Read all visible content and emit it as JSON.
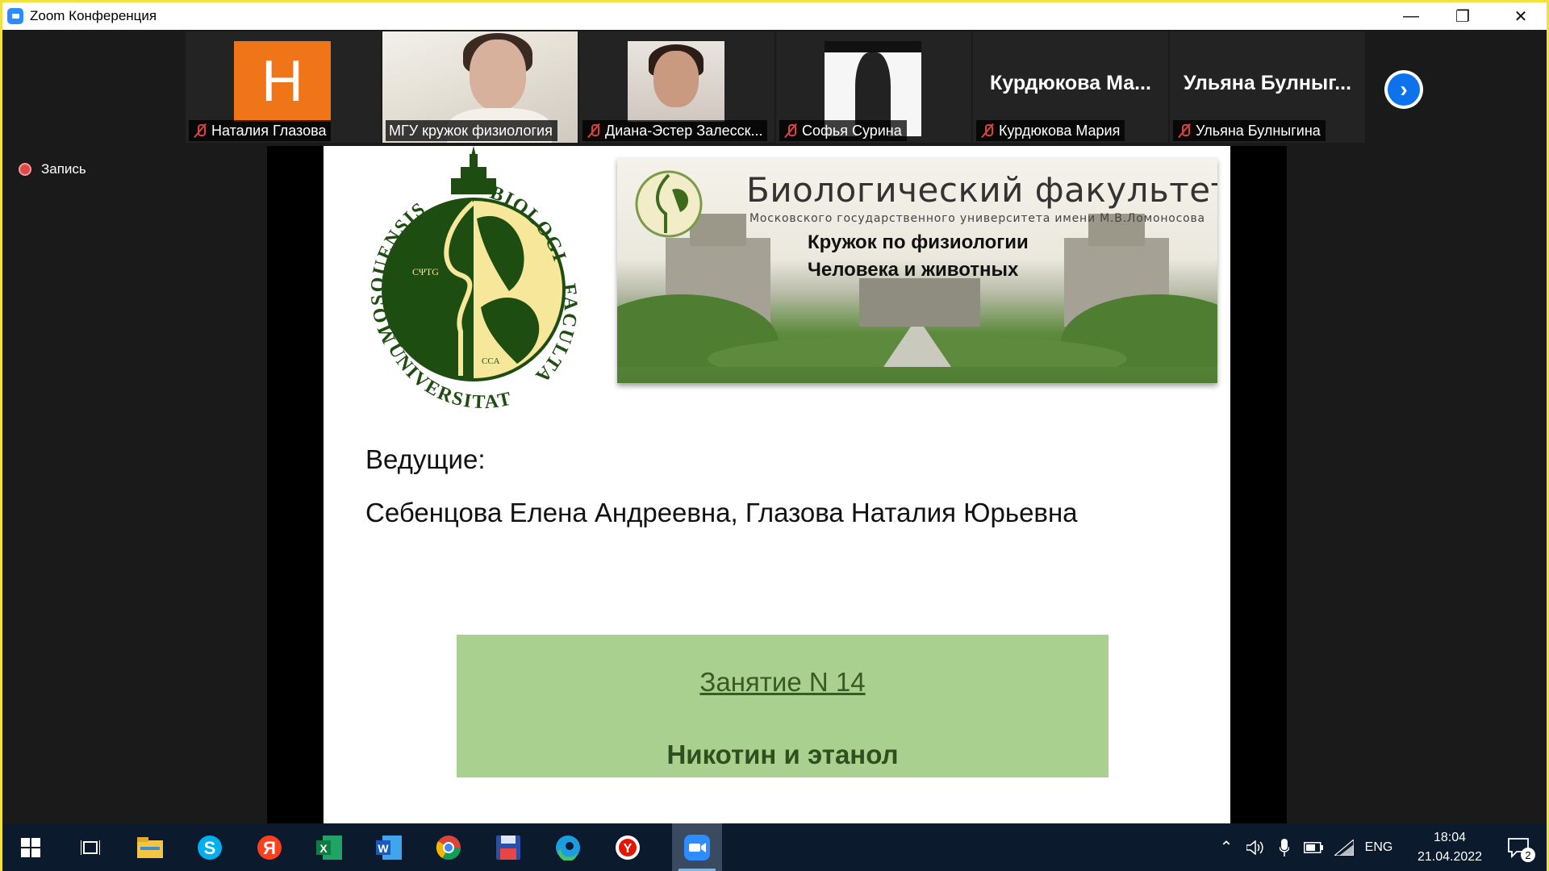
{
  "window": {
    "title": "Zoom Конференция",
    "minimize": "—",
    "restore": "❐",
    "close": "✕"
  },
  "participants": [
    {
      "name": "Наталия Глазова",
      "avatar_letter": "H",
      "avatar_color": "#f07418",
      "muted": true,
      "kind": "avatar"
    },
    {
      "name": "МГУ кружок физиология",
      "muted": false,
      "kind": "video-woman",
      "active": true
    },
    {
      "name": "Диана-Эстер Залесск...",
      "muted": true,
      "kind": "video-girl"
    },
    {
      "name": "Софья Сурина",
      "muted": true,
      "kind": "image-manga"
    },
    {
      "name": "Курдюкова Мария",
      "display": "Курдюкова  Ма...",
      "muted": true,
      "kind": "name-only"
    },
    {
      "name": "Ульяна Булныгина",
      "display": "Ульяна  Булныг...",
      "muted": true,
      "kind": "name-only"
    }
  ],
  "next_page_glyph": "›",
  "recording": {
    "label": "Запись"
  },
  "slide": {
    "banner_title": "Биологический факультет",
    "banner_subtitle": "Московского государственного университета имени М.В.Ломоносова",
    "banner_line1": "Кружок по физиологии",
    "banner_line2": "Человека и животных",
    "hosts_label": "Ведущие:",
    "hosts_names": "Себенцова Елена Андреевна, Глазова Наталия Юрьевна",
    "lesson_number": "Занятие N 14",
    "lesson_topic": "Никотин и этанол",
    "emblem_text_left": "MOSQUENSIS",
    "emblem_text_right": "BIOLOGIAE",
    "emblem_text_right2": "FACULTAS",
    "emblem_text_bottom": "UNIVERSITATIS",
    "emblem_ctg": "CΨTG",
    "emblem_cca": "CCA",
    "emblem_green": "#1e4d12",
    "emblem_yellow": "#f6e79a"
  },
  "taskbar": {
    "language": "ENG",
    "time": "18:04",
    "date": "21.04.2022",
    "notifications": "2"
  }
}
